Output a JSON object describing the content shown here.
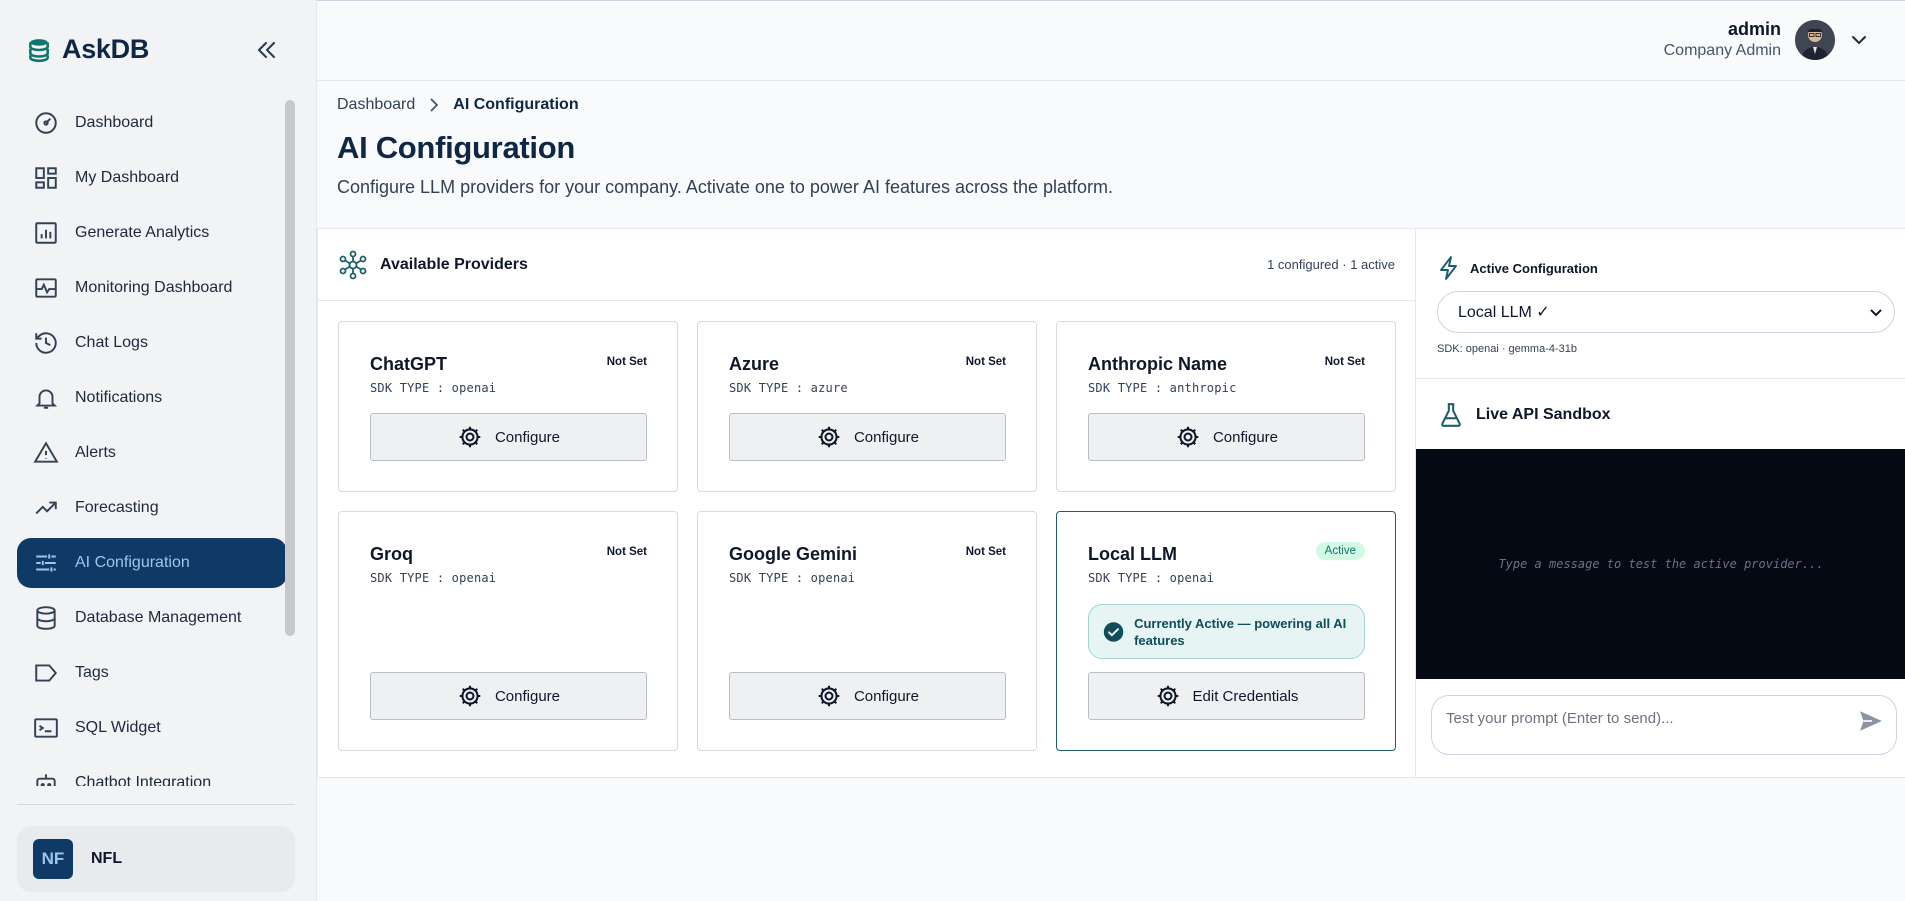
{
  "app": {
    "name": "AskDB"
  },
  "sidebar": {
    "items": [
      {
        "label": "Dashboard",
        "icon": "dashboard-gauge-icon"
      },
      {
        "label": "My Dashboard",
        "icon": "grid-layout-icon"
      },
      {
        "label": "Generate Analytics",
        "icon": "bar-chart-icon"
      },
      {
        "label": "Monitoring Dashboard",
        "icon": "monitor-pulse-icon"
      },
      {
        "label": "Chat Logs",
        "icon": "history-icon"
      },
      {
        "label": "Notifications",
        "icon": "bell-icon"
      },
      {
        "label": "Alerts",
        "icon": "warning-triangle-icon"
      },
      {
        "label": "Forecasting",
        "icon": "trend-up-icon"
      },
      {
        "label": "AI Configuration",
        "icon": "sliders-icon",
        "active": true
      },
      {
        "label": "Database Management",
        "icon": "database-icon"
      },
      {
        "label": "Tags",
        "icon": "tag-icon"
      },
      {
        "label": "SQL Widget",
        "icon": "terminal-icon"
      },
      {
        "label": "Chatbot Integration",
        "icon": "bot-icon"
      }
    ],
    "company": {
      "initials": "NF",
      "name": "NFL"
    }
  },
  "user": {
    "name": "admin",
    "role": "Company Admin"
  },
  "breadcrumb": {
    "parent": "Dashboard",
    "current": "AI Configuration"
  },
  "page": {
    "title": "AI Configuration",
    "subtitle": "Configure LLM providers for your company. Activate one to power AI features across the platform."
  },
  "providers_panel": {
    "title": "Available Providers",
    "meta": "1 configured · 1 active",
    "cards": [
      {
        "name": "ChatGPT",
        "sdk": "SDK TYPE : openai",
        "status": "Not Set",
        "button": "Configure"
      },
      {
        "name": "Azure",
        "sdk": "SDK TYPE : azure",
        "status": "Not Set",
        "button": "Configure"
      },
      {
        "name": "Anthropic Name",
        "sdk": "SDK TYPE : anthropic",
        "status": "Not Set",
        "button": "Configure"
      },
      {
        "name": "Groq",
        "sdk": "SDK TYPE : openai",
        "status": "Not Set",
        "button": "Configure"
      },
      {
        "name": "Google Gemini",
        "sdk": "SDK TYPE : openai",
        "status": "Not Set",
        "button": "Configure"
      },
      {
        "name": "Local LLM",
        "sdk": "SDK TYPE : openai",
        "status": "Active",
        "active_note": "Currently Active — powering all AI features",
        "button": "Edit Credentials"
      }
    ]
  },
  "active_config": {
    "title": "Active Configuration",
    "selected": "Local LLM ✓",
    "sdk_line": "SDK: openai · gemma-4-31b"
  },
  "sandbox": {
    "title": "Live API Sandbox",
    "terminal_placeholder": "Type a message to test the active provider...",
    "input_placeholder": "Test your prompt (Enter to send)..."
  },
  "colors": {
    "accent": "#0f3a66",
    "teal": "#1d5e6e",
    "active_bg": "#d1fae5"
  }
}
